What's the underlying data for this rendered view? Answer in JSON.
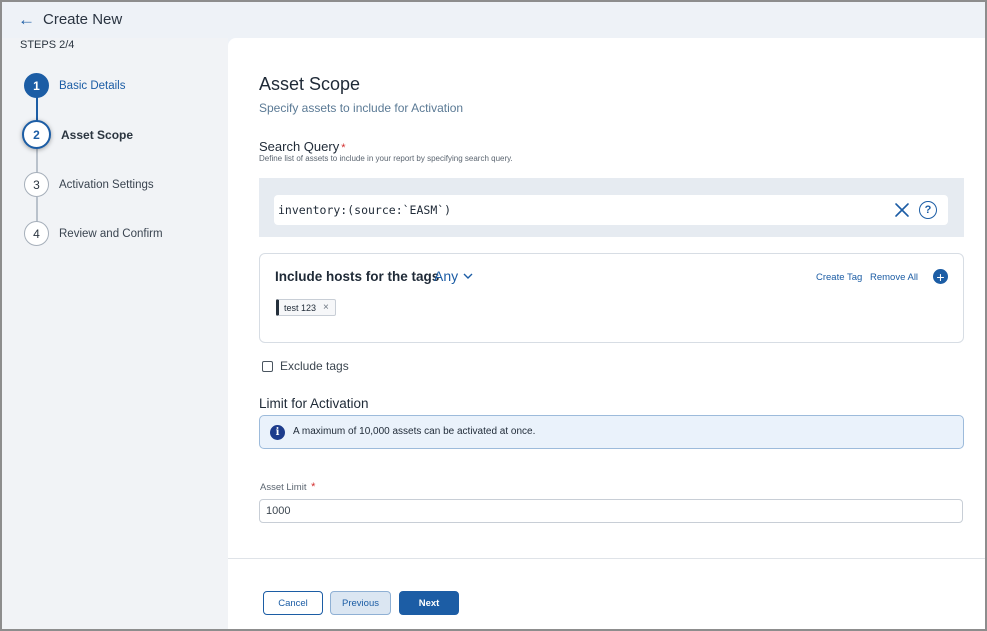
{
  "header": {
    "back_icon": "arrow-left-icon",
    "title": "Create New"
  },
  "steps": {
    "label": "STEPS 2/4",
    "items": [
      {
        "number": "1",
        "label": "Basic Details",
        "state": "complete"
      },
      {
        "number": "2",
        "label": "Asset Scope",
        "state": "current"
      },
      {
        "number": "3",
        "label": "Activation Settings",
        "state": "pending"
      },
      {
        "number": "4",
        "label": "Review and Confirm",
        "state": "pending"
      }
    ]
  },
  "section": {
    "title": "Asset Scope",
    "subtitle": "Specify assets to include for Activation"
  },
  "search_query": {
    "label": "Search Query",
    "required_mark": "*",
    "help": "Define list of assets to include in your report by specifying search query.",
    "value": "inventory:(source:`EASM`)",
    "clear_icon": "close-icon",
    "help_icon": "question-circle-icon",
    "help_glyph": "?"
  },
  "tags": {
    "title": "Include hosts for the tags",
    "match_mode": "Any",
    "create_tag": "Create Tag",
    "remove_all": "Remove All",
    "add_icon": "plus-circle-icon",
    "add_glyph": "+",
    "chip_remove_glyph": "×",
    "chips": [
      {
        "label": "test 123"
      }
    ]
  },
  "exclude_tags": {
    "label": "Exclude tags",
    "checked": false
  },
  "limit": {
    "title": "Limit for Activation",
    "info_icon": "info-icon",
    "info_glyph": "i",
    "info_text": "A maximum of 10,000 assets can be activated at once.",
    "asset_limit_label": "Asset Limit",
    "required_mark": "*",
    "asset_limit_value": "1000"
  },
  "footer": {
    "cancel": "Cancel",
    "previous": "Previous",
    "next": "Next"
  },
  "colors": {
    "accent": "#1c5da5",
    "required": "#d32f2f",
    "info_bg": "#eaf2fb"
  }
}
